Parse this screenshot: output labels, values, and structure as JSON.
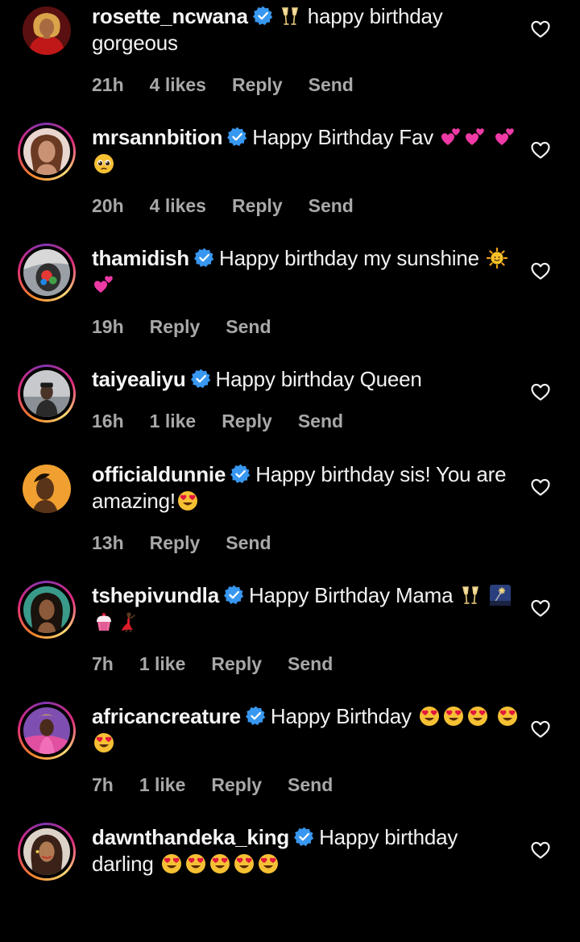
{
  "comments": [
    {
      "username": "rosette_ncwana",
      "pre_emoji": "champagne-icon",
      "text": "happy birthday gorgeous",
      "time": "21h",
      "likes": "4 likes",
      "reply": "Reply",
      "send": "Send"
    },
    {
      "username": "mrsannbition",
      "text": "Happy Birthday Fav",
      "emojis": [
        "two-hearts-icon",
        "two-hearts-icon",
        "two-hearts-icon",
        "pleading-face-icon"
      ],
      "time": "20h",
      "likes": "4 likes",
      "reply": "Reply",
      "send": "Send"
    },
    {
      "username": "thamidish",
      "text": "Happy birthday my sunshine",
      "emojis": [
        "sun-face-icon",
        "two-hearts-icon"
      ],
      "time": "19h",
      "reply": "Reply",
      "send": "Send"
    },
    {
      "username": "taiyealiyu",
      "text": "Happy birthday Queen",
      "time": "16h",
      "likes": "1 like",
      "reply": "Reply",
      "send": "Send"
    },
    {
      "username": "officialdunnie",
      "text": "Happy birthday sis! You are amazing!",
      "emojis": [
        "heart-eyes-icon"
      ],
      "time": "13h",
      "reply": "Reply",
      "send": "Send"
    },
    {
      "username": "tshepivundla",
      "text": "Happy Birthday Mama",
      "emojis": [
        "champagne-icon",
        "sparkler-icon",
        "cupcake-icon",
        "dancer-icon"
      ],
      "time": "7h",
      "likes": "1 like",
      "reply": "Reply",
      "send": "Send"
    },
    {
      "username": "africancreature",
      "text": "Happy Birthday",
      "emojis": [
        "heart-eyes-icon",
        "heart-eyes-icon",
        "heart-eyes-icon",
        "heart-eyes-icon",
        "heart-eyes-icon"
      ],
      "time": "7h",
      "likes": "1 like",
      "reply": "Reply",
      "send": "Send"
    },
    {
      "username": "dawnthandeka_king",
      "text": "Happy birthday darling",
      "emojis": [
        "heart-eyes-icon",
        "heart-eyes-icon",
        "heart-eyes-icon",
        "heart-eyes-icon",
        "heart-eyes-icon"
      ]
    }
  ],
  "colors": {
    "background": "#000000",
    "text": "#f2f2f2",
    "meta": "#a8a8a8",
    "verified": "#3897f0"
  }
}
